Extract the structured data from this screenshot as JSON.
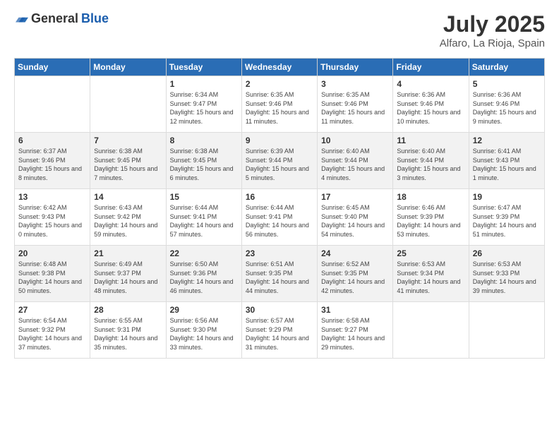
{
  "logo": {
    "general": "General",
    "blue": "Blue"
  },
  "header": {
    "month": "July 2025",
    "location": "Alfaro, La Rioja, Spain"
  },
  "weekdays": [
    "Sunday",
    "Monday",
    "Tuesday",
    "Wednesday",
    "Thursday",
    "Friday",
    "Saturday"
  ],
  "weeks": [
    [
      {
        "day": "",
        "info": ""
      },
      {
        "day": "",
        "info": ""
      },
      {
        "day": "1",
        "sunrise": "Sunrise: 6:34 AM",
        "sunset": "Sunset: 9:47 PM",
        "daylight": "Daylight: 15 hours and 12 minutes."
      },
      {
        "day": "2",
        "sunrise": "Sunrise: 6:35 AM",
        "sunset": "Sunset: 9:46 PM",
        "daylight": "Daylight: 15 hours and 11 minutes."
      },
      {
        "day": "3",
        "sunrise": "Sunrise: 6:35 AM",
        "sunset": "Sunset: 9:46 PM",
        "daylight": "Daylight: 15 hours and 11 minutes."
      },
      {
        "day": "4",
        "sunrise": "Sunrise: 6:36 AM",
        "sunset": "Sunset: 9:46 PM",
        "daylight": "Daylight: 15 hours and 10 minutes."
      },
      {
        "day": "5",
        "sunrise": "Sunrise: 6:36 AM",
        "sunset": "Sunset: 9:46 PM",
        "daylight": "Daylight: 15 hours and 9 minutes."
      }
    ],
    [
      {
        "day": "6",
        "sunrise": "Sunrise: 6:37 AM",
        "sunset": "Sunset: 9:46 PM",
        "daylight": "Daylight: 15 hours and 8 minutes."
      },
      {
        "day": "7",
        "sunrise": "Sunrise: 6:38 AM",
        "sunset": "Sunset: 9:45 PM",
        "daylight": "Daylight: 15 hours and 7 minutes."
      },
      {
        "day": "8",
        "sunrise": "Sunrise: 6:38 AM",
        "sunset": "Sunset: 9:45 PM",
        "daylight": "Daylight: 15 hours and 6 minutes."
      },
      {
        "day": "9",
        "sunrise": "Sunrise: 6:39 AM",
        "sunset": "Sunset: 9:44 PM",
        "daylight": "Daylight: 15 hours and 5 minutes."
      },
      {
        "day": "10",
        "sunrise": "Sunrise: 6:40 AM",
        "sunset": "Sunset: 9:44 PM",
        "daylight": "Daylight: 15 hours and 4 minutes."
      },
      {
        "day": "11",
        "sunrise": "Sunrise: 6:40 AM",
        "sunset": "Sunset: 9:44 PM",
        "daylight": "Daylight: 15 hours and 3 minutes."
      },
      {
        "day": "12",
        "sunrise": "Sunrise: 6:41 AM",
        "sunset": "Sunset: 9:43 PM",
        "daylight": "Daylight: 15 hours and 1 minute."
      }
    ],
    [
      {
        "day": "13",
        "sunrise": "Sunrise: 6:42 AM",
        "sunset": "Sunset: 9:43 PM",
        "daylight": "Daylight: 15 hours and 0 minutes."
      },
      {
        "day": "14",
        "sunrise": "Sunrise: 6:43 AM",
        "sunset": "Sunset: 9:42 PM",
        "daylight": "Daylight: 14 hours and 59 minutes."
      },
      {
        "day": "15",
        "sunrise": "Sunrise: 6:44 AM",
        "sunset": "Sunset: 9:41 PM",
        "daylight": "Daylight: 14 hours and 57 minutes."
      },
      {
        "day": "16",
        "sunrise": "Sunrise: 6:44 AM",
        "sunset": "Sunset: 9:41 PM",
        "daylight": "Daylight: 14 hours and 56 minutes."
      },
      {
        "day": "17",
        "sunrise": "Sunrise: 6:45 AM",
        "sunset": "Sunset: 9:40 PM",
        "daylight": "Daylight: 14 hours and 54 minutes."
      },
      {
        "day": "18",
        "sunrise": "Sunrise: 6:46 AM",
        "sunset": "Sunset: 9:39 PM",
        "daylight": "Daylight: 14 hours and 53 minutes."
      },
      {
        "day": "19",
        "sunrise": "Sunrise: 6:47 AM",
        "sunset": "Sunset: 9:39 PM",
        "daylight": "Daylight: 14 hours and 51 minutes."
      }
    ],
    [
      {
        "day": "20",
        "sunrise": "Sunrise: 6:48 AM",
        "sunset": "Sunset: 9:38 PM",
        "daylight": "Daylight: 14 hours and 50 minutes."
      },
      {
        "day": "21",
        "sunrise": "Sunrise: 6:49 AM",
        "sunset": "Sunset: 9:37 PM",
        "daylight": "Daylight: 14 hours and 48 minutes."
      },
      {
        "day": "22",
        "sunrise": "Sunrise: 6:50 AM",
        "sunset": "Sunset: 9:36 PM",
        "daylight": "Daylight: 14 hours and 46 minutes."
      },
      {
        "day": "23",
        "sunrise": "Sunrise: 6:51 AM",
        "sunset": "Sunset: 9:35 PM",
        "daylight": "Daylight: 14 hours and 44 minutes."
      },
      {
        "day": "24",
        "sunrise": "Sunrise: 6:52 AM",
        "sunset": "Sunset: 9:35 PM",
        "daylight": "Daylight: 14 hours and 42 minutes."
      },
      {
        "day": "25",
        "sunrise": "Sunrise: 6:53 AM",
        "sunset": "Sunset: 9:34 PM",
        "daylight": "Daylight: 14 hours and 41 minutes."
      },
      {
        "day": "26",
        "sunrise": "Sunrise: 6:53 AM",
        "sunset": "Sunset: 9:33 PM",
        "daylight": "Daylight: 14 hours and 39 minutes."
      }
    ],
    [
      {
        "day": "27",
        "sunrise": "Sunrise: 6:54 AM",
        "sunset": "Sunset: 9:32 PM",
        "daylight": "Daylight: 14 hours and 37 minutes."
      },
      {
        "day": "28",
        "sunrise": "Sunrise: 6:55 AM",
        "sunset": "Sunset: 9:31 PM",
        "daylight": "Daylight: 14 hours and 35 minutes."
      },
      {
        "day": "29",
        "sunrise": "Sunrise: 6:56 AM",
        "sunset": "Sunset: 9:30 PM",
        "daylight": "Daylight: 14 hours and 33 minutes."
      },
      {
        "day": "30",
        "sunrise": "Sunrise: 6:57 AM",
        "sunset": "Sunset: 9:29 PM",
        "daylight": "Daylight: 14 hours and 31 minutes."
      },
      {
        "day": "31",
        "sunrise": "Sunrise: 6:58 AM",
        "sunset": "Sunset: 9:27 PM",
        "daylight": "Daylight: 14 hours and 29 minutes."
      },
      {
        "day": "",
        "info": ""
      },
      {
        "day": "",
        "info": ""
      }
    ]
  ]
}
